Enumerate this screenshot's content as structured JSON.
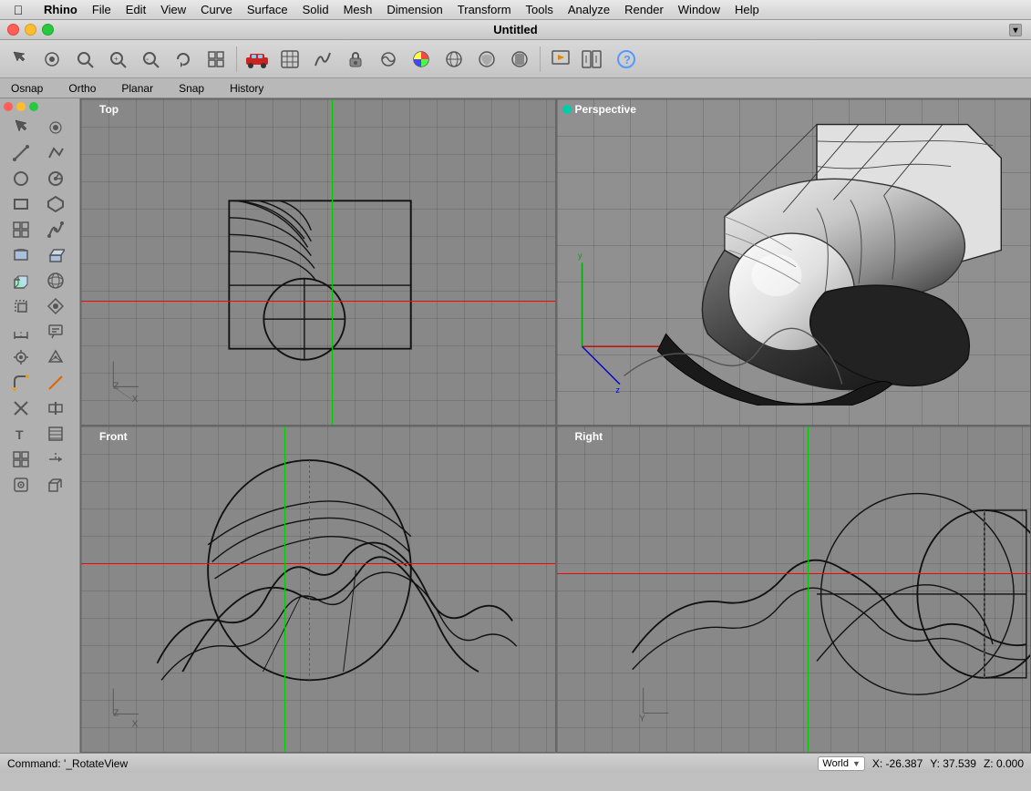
{
  "app": {
    "title": "Rhino",
    "window_title": "Untitled"
  },
  "menubar": {
    "apple": "⌘",
    "items": [
      "Rhino",
      "File",
      "Edit",
      "View",
      "Curve",
      "Surface",
      "Solid",
      "Mesh",
      "Dimension",
      "Transform",
      "Tools",
      "Analyze",
      "Render",
      "Window",
      "Help"
    ]
  },
  "toolbar": {
    "tools": [
      "✋",
      "⊕",
      "🔍",
      "🔎",
      "🔎",
      "⟳",
      "⊞",
      "🚗",
      "⊡",
      "◎",
      "⊕",
      "🔒",
      "◈",
      "🎨",
      "⊙",
      "⊡",
      "◆",
      "🔔",
      "❓"
    ]
  },
  "snapbar": {
    "items": [
      {
        "label": "Osnap",
        "active": false
      },
      {
        "label": "Ortho",
        "active": false
      },
      {
        "label": "Planar",
        "active": false
      },
      {
        "label": "Snap",
        "active": false
      },
      {
        "label": "History",
        "active": false
      }
    ]
  },
  "viewports": {
    "top": {
      "label": "Top",
      "dot_color": "gray"
    },
    "perspective": {
      "label": "Perspective",
      "dot_color": "teal"
    },
    "front": {
      "label": "Front",
      "dot_color": "gray"
    },
    "right": {
      "label": "Right",
      "dot_color": "gray"
    }
  },
  "statusbar": {
    "command": "Command: '_RotateView",
    "coord_system": "World",
    "x": "X: -26.387",
    "y": "Y: 37.539",
    "z": "Z: 0.000"
  }
}
